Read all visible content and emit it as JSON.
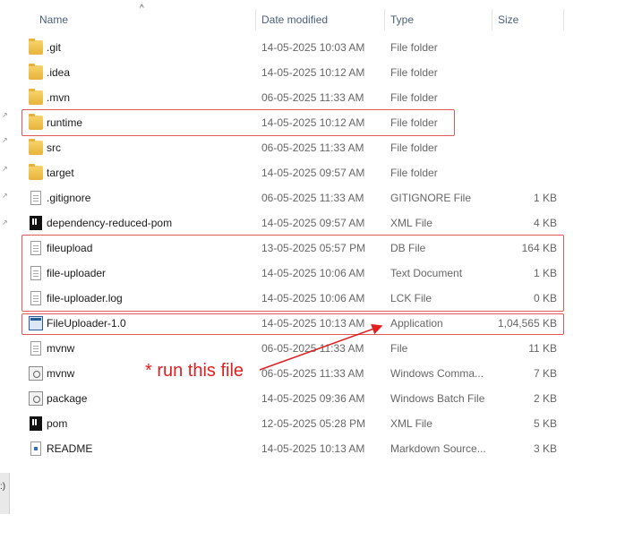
{
  "columns": {
    "name": "Name",
    "date_modified": "Date modified",
    "type": "Type",
    "size": "Size"
  },
  "sort_indicator": "^",
  "left_strip_tab": ":)",
  "files": [
    {
      "name": ".git",
      "date": "14-05-2025 10:03 AM",
      "type": "File folder",
      "size": "",
      "icon": "folder-icon"
    },
    {
      "name": ".idea",
      "date": "14-05-2025 10:12 AM",
      "type": "File folder",
      "size": "",
      "icon": "folder-icon"
    },
    {
      "name": ".mvn",
      "date": "06-05-2025 11:33 AM",
      "type": "File folder",
      "size": "",
      "icon": "folder-icon"
    },
    {
      "name": "runtime",
      "date": "14-05-2025 10:12 AM",
      "type": "File folder",
      "size": "",
      "icon": "folder-icon"
    },
    {
      "name": "src",
      "date": "06-05-2025 11:33 AM",
      "type": "File folder",
      "size": "",
      "icon": "folder-icon"
    },
    {
      "name": "target",
      "date": "14-05-2025 09:57 AM",
      "type": "File folder",
      "size": "",
      "icon": "folder-icon"
    },
    {
      "name": ".gitignore",
      "date": "06-05-2025 11:33 AM",
      "type": "GITIGNORE File",
      "size": "1 KB",
      "icon": "file-icon"
    },
    {
      "name": "dependency-reduced-pom",
      "date": "14-05-2025 09:57 AM",
      "type": "XML File",
      "size": "4 KB",
      "icon": "intellij-icon"
    },
    {
      "name": "fileupload",
      "date": "13-05-2025 05:57 PM",
      "type": "DB File",
      "size": "164 KB",
      "icon": "file-icon"
    },
    {
      "name": "file-uploader",
      "date": "14-05-2025 10:06 AM",
      "type": "Text Document",
      "size": "1 KB",
      "icon": "file-icon"
    },
    {
      "name": "file-uploader.log",
      "date": "14-05-2025 10:06 AM",
      "type": "LCK File",
      "size": "0 KB",
      "icon": "file-icon"
    },
    {
      "name": "FileUploader-1.0",
      "date": "14-05-2025 10:13 AM",
      "type": "Application",
      "size": "1,04,565 KB",
      "icon": "app-icon"
    },
    {
      "name": "mvnw",
      "date": "06-05-2025 11:33 AM",
      "type": "File",
      "size": "11 KB",
      "icon": "file-icon"
    },
    {
      "name": "mvnw",
      "date": "06-05-2025 11:33 AM",
      "type": "Windows Comma...",
      "size": "7 KB",
      "icon": "cmd-icon"
    },
    {
      "name": "package",
      "date": "14-05-2025 09:36 AM",
      "type": "Windows Batch File",
      "size": "2 KB",
      "icon": "cmd-icon"
    },
    {
      "name": "pom",
      "date": "12-05-2025 05:28 PM",
      "type": "XML File",
      "size": "5 KB",
      "icon": "intellij-icon"
    },
    {
      "name": "README",
      "date": "14-05-2025 10:13 AM",
      "type": "Markdown Source...",
      "size": "3 KB",
      "icon": "md-icon"
    }
  ],
  "annotation": {
    "text": "* run this file",
    "color": "#e02020"
  },
  "highlight_color": "#e15a5a"
}
